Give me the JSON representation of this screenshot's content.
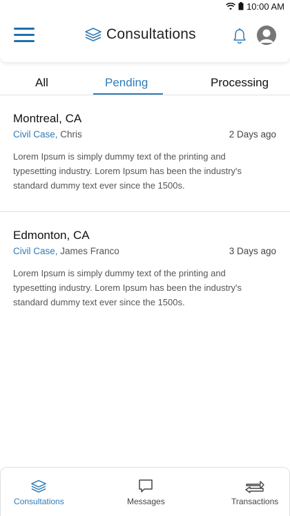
{
  "status_bar": {
    "time": "10:00 AM"
  },
  "header": {
    "title": "Consultations",
    "icons": {
      "menu": "menu-icon",
      "logo": "layers-icon",
      "bell": "bell-icon",
      "avatar": "user-avatar-icon"
    }
  },
  "tabs": [
    {
      "label": "All",
      "active": false
    },
    {
      "label": "Pending",
      "active": true
    },
    {
      "label": "Processing",
      "active": false
    }
  ],
  "consultations": [
    {
      "city": "Montreal, CA",
      "case_type": "Civil Case,",
      "client": "Chris",
      "time_ago": "2 Days ago",
      "description": "Lorem Ipsum is simply dummy text of the printing and typesetting industry. Lorem Ipsum has been the industry's standard dummy text ever since the 1500s."
    },
    {
      "city": "Edmonton, CA",
      "case_type": "Civil Case,",
      "client": "James Franco",
      "time_ago": "3 Days ago",
      "description": "Lorem Ipsum is simply dummy text of the printing and typesetting industry. Lorem Ipsum has been the industry's standard dummy text ever since the 1500s."
    }
  ],
  "bottom_nav": [
    {
      "label": "Consultations",
      "icon": "layers-icon",
      "active": true
    },
    {
      "label": "Messages",
      "icon": "message-icon",
      "active": false
    },
    {
      "label": "Transactions",
      "icon": "transfer-icon",
      "active": false
    }
  ],
  "colors": {
    "accent": "#2e7bb8",
    "menu": "#1f6fad",
    "text": "#222222",
    "muted": "#555555"
  }
}
